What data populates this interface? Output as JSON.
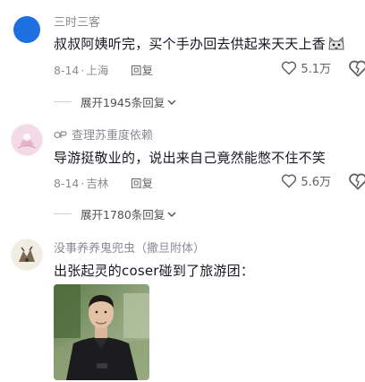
{
  "comments": [
    {
      "username": "三时三客",
      "text": "叔叔阿姨听完，买个手办回去供起来天天上香",
      "emoji": "cat-face-emoji",
      "date": "8-14",
      "location": "上海",
      "reply_label": "回复",
      "likes": "5.1万",
      "expand_label": "展开1945条回复"
    },
    {
      "badge": "ip-badge-icon",
      "username": "查理苏重度依赖",
      "text": "导游挺敬业的，说出来自己竟然能憋不住不笑",
      "date": "8-14",
      "location": "吉林",
      "reply_label": "回复",
      "likes": "5.6万",
      "expand_label": "展开1780条回复"
    },
    {
      "username": "没事养养鬼兜虫（撒旦附体）",
      "text": "出张起灵的coser碰到了旅游团："
    }
  ],
  "colors": {
    "text_primary": "#161823",
    "text_secondary": "#8a8b91",
    "avatar_blue": "#1e6fe0"
  }
}
